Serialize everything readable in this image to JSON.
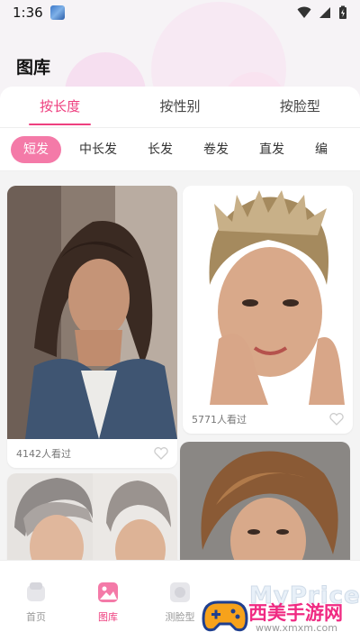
{
  "status_bar": {
    "time": "1:36"
  },
  "header": {
    "title": "图库"
  },
  "tabs": [
    {
      "label": "按长度",
      "active": true
    },
    {
      "label": "按性别",
      "active": false
    },
    {
      "label": "按脸型",
      "active": false
    }
  ],
  "chips": [
    {
      "label": "短发",
      "active": true
    },
    {
      "label": "中长发",
      "active": false
    },
    {
      "label": "长发",
      "active": false
    },
    {
      "label": "卷发",
      "active": false
    },
    {
      "label": "直发",
      "active": false
    },
    {
      "label": "编",
      "active": false
    }
  ],
  "cards": [
    {
      "views": "4142人看过"
    },
    {
      "views": "5771人看过"
    },
    {
      "views": ""
    },
    {
      "views": ""
    }
  ],
  "bottom_nav": [
    {
      "label": "首页",
      "icon": "home-icon",
      "active": false
    },
    {
      "label": "图库",
      "icon": "gallery-icon",
      "active": true
    },
    {
      "label": "测脸型",
      "icon": "face-scan-icon",
      "active": false
    },
    {
      "label": "",
      "icon": "",
      "active": false
    },
    {
      "label": "",
      "icon": "",
      "active": false
    }
  ],
  "watermark": {
    "big": "MyPrice",
    "cn": "西美手游网",
    "url": "www.xmxm.com"
  },
  "colors": {
    "accent": "#ee3f7f",
    "chip_active": "#f47aa8"
  }
}
